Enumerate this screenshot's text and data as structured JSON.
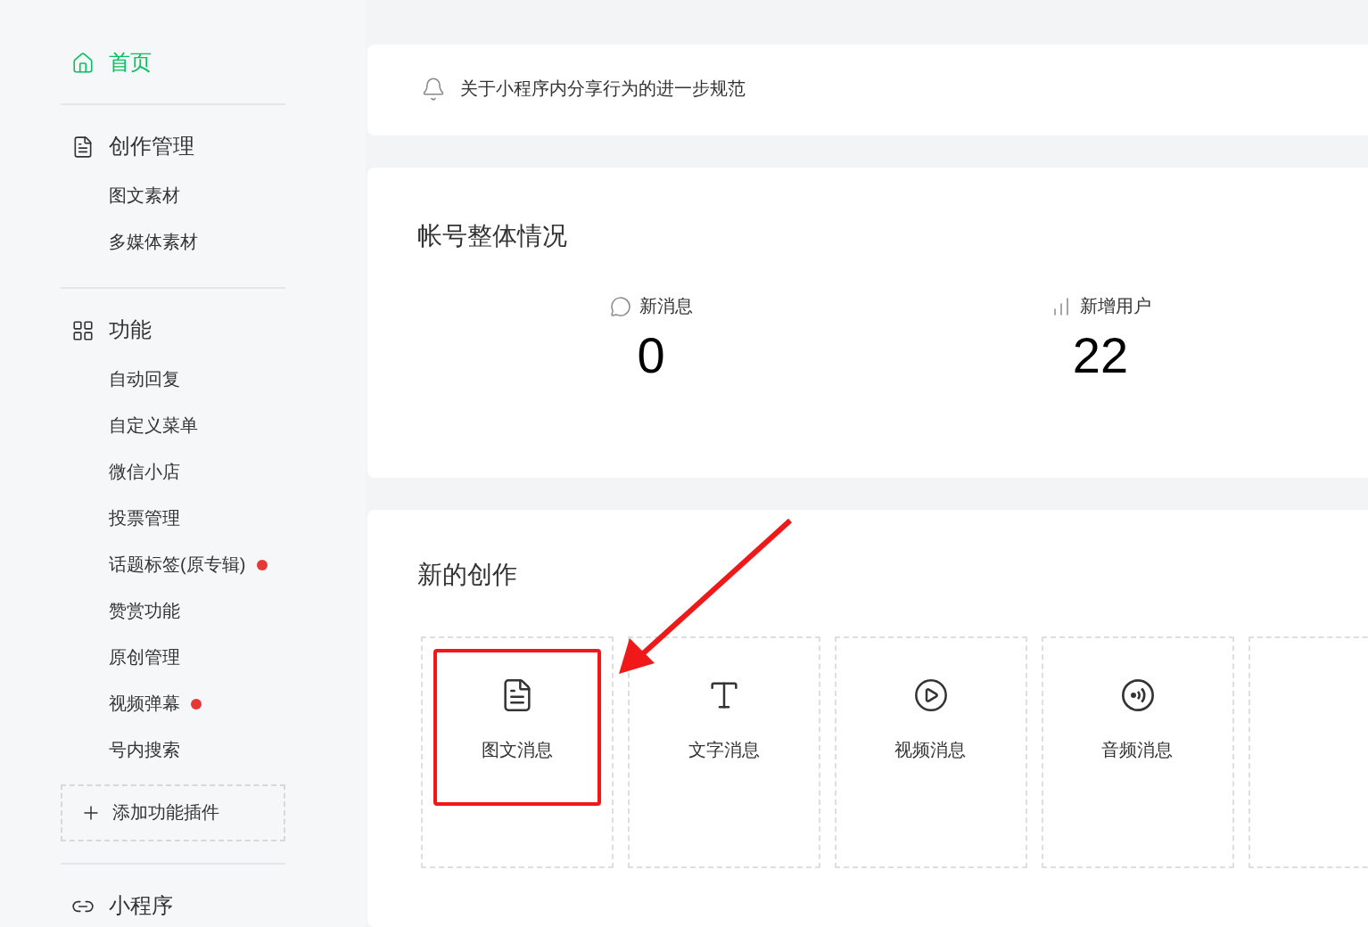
{
  "sidebar": {
    "sections": [
      {
        "kind": "home",
        "label": "首页",
        "selected": true
      },
      {
        "kind": "document",
        "label": "创作管理",
        "selected": false,
        "items": [
          {
            "label": "图文素材",
            "selected": false,
            "dot": false
          },
          {
            "label": "多媒体素材",
            "selected": false,
            "dot": false
          }
        ]
      },
      {
        "kind": "grid",
        "label": "功能",
        "selected": false,
        "items": [
          {
            "label": "自动回复",
            "selected": false,
            "dot": false
          },
          {
            "label": "自定义菜单",
            "selected": false,
            "dot": false
          },
          {
            "label": "微信小店",
            "selected": false,
            "dot": false
          },
          {
            "label": "投票管理",
            "selected": false,
            "dot": false
          },
          {
            "label": "话题标签(原专辑)",
            "selected": false,
            "dot": true
          },
          {
            "label": "赞赏功能",
            "selected": false,
            "dot": false
          },
          {
            "label": "原创管理",
            "selected": false,
            "dot": false
          },
          {
            "label": "视频弹幕",
            "selected": false,
            "dot": true
          },
          {
            "label": "号内搜索",
            "selected": false,
            "dot": false
          }
        ],
        "add_button": "添加功能插件"
      },
      {
        "kind": "link",
        "label": "小程序",
        "selected": false
      }
    ]
  },
  "notice": {
    "text": "关于小程序内分享行为的进一步规范"
  },
  "account_overview": {
    "title": "帐号整体情况",
    "stats": [
      {
        "kind": "chat",
        "label": "新消息",
        "value": "0"
      },
      {
        "kind": "bars",
        "label": "新增用户",
        "value": "22"
      }
    ]
  },
  "new_creation": {
    "title": "新的创作",
    "tiles": [
      {
        "kind": "document",
        "label": "图文消息",
        "highlighted": true
      },
      {
        "kind": "text",
        "label": "文字消息",
        "highlighted": false
      },
      {
        "kind": "play",
        "label": "视频消息",
        "highlighted": false
      },
      {
        "kind": "audio",
        "label": "音频消息",
        "highlighted": false
      }
    ]
  }
}
